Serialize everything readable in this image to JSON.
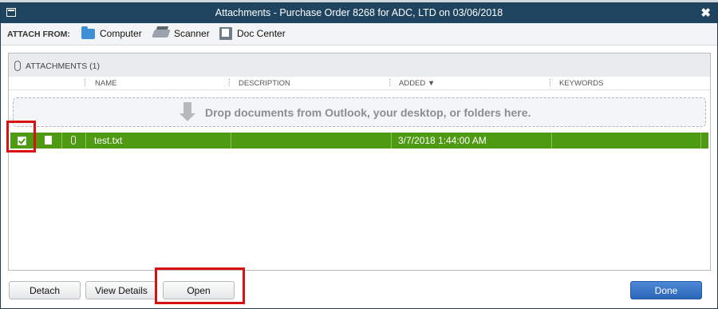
{
  "window": {
    "title": "Attachments - Purchase Order 8268 for ADC, LTD on 03/06/2018",
    "close_glyph": "✖"
  },
  "toolbar": {
    "attach_from_label": "ATTACH FROM:",
    "buttons": [
      {
        "label": "Computer",
        "icon": "folder-icon"
      },
      {
        "label": "Scanner",
        "icon": "scanner-icon"
      },
      {
        "label": "Doc Center",
        "icon": "doc-center-icon"
      }
    ]
  },
  "attachments": {
    "heading": "ATTACHMENTS (1)",
    "columns": [
      "NAME",
      "DESCRIPTION",
      "ADDED ▼",
      "KEYWORDS"
    ],
    "drop_text": "Drop documents from Outlook, your desktop, or folders here.",
    "rows": [
      {
        "checked": true,
        "name": "test.txt",
        "description": "",
        "added": "3/7/2018 1:44:00 AM",
        "keywords": ""
      }
    ]
  },
  "footer": {
    "detach": "Detach",
    "view_details": "View Details",
    "open": "Open",
    "done": "Done"
  },
  "colors": {
    "titlebar": "#1f4460",
    "selected_row": "#4f9a13",
    "done_button": "#2b67b9",
    "highlight": "#d91010"
  }
}
